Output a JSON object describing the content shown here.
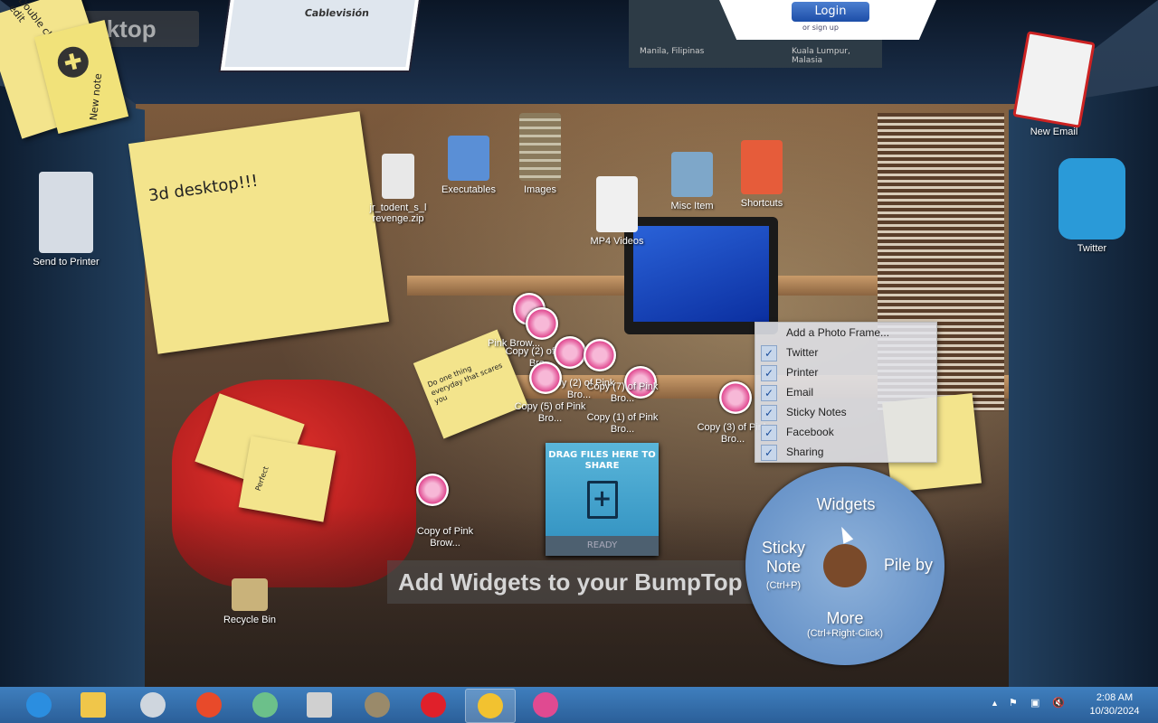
{
  "desktop": {
    "label": "Desktop"
  },
  "icons": [
    {
      "label": "jr_todent_s_l revenge.zip",
      "color": "#e8e8e8"
    },
    {
      "label": "Executables",
      "color": "#5a8fd6"
    },
    {
      "label": "Images",
      "color": "#8a7a5c"
    },
    {
      "label": "MP4 Videos",
      "color": "#f0f0f0"
    },
    {
      "label": "Misc Item",
      "color": "#7ea7c9"
    },
    {
      "label": "Shortcuts",
      "color": "#e65c3a"
    },
    {
      "label": "Recycle Bin",
      "color": "#c9b27a"
    },
    {
      "label": "Send to Printer",
      "color": "#d6dce4"
    },
    {
      "label": "New Email",
      "color": "#f2f2f2"
    },
    {
      "label": "Twitter",
      "color": "#2a9ad8"
    }
  ],
  "pink_items": [
    "Pink Brow...",
    "Copy (2) of Pink Bro...",
    "Copy (2) of Pink Bro...",
    "Copy (7) of Pink Bro...",
    "Copy (5) of Pink Bro...",
    "Copy (1) of Pink Bro...",
    "Copy (3) of Pink Bro...",
    "Copy of Pink Brow..."
  ],
  "stickies": {
    "main": "3d desktop!!!",
    "quote": "Do one thing everyday that scares you",
    "side1": "Double click to edit",
    "new_note": "New note",
    "perfect": "Perfect"
  },
  "share": {
    "title": "DRAG FILES HERE TO SHARE",
    "status": "READY"
  },
  "banner": "Add Widgets to your BumpTop",
  "ceiling": {
    "login": "Login",
    "signup": "or sign up",
    "cable": "Cablevisión",
    "manila": "Manila, Filipinas",
    "kuala": "Kuala Lumpur, Malasia"
  },
  "menu": {
    "add_photo": "Add a Photo Frame...",
    "items": [
      {
        "label": "Twitter",
        "checked": true
      },
      {
        "label": "Printer",
        "checked": true
      },
      {
        "label": "Email",
        "checked": true
      },
      {
        "label": "Sticky Notes",
        "checked": true
      },
      {
        "label": "Facebook",
        "checked": true
      },
      {
        "label": "Sharing",
        "checked": true
      }
    ],
    "check": "✓"
  },
  "pie": {
    "top": "Widgets",
    "left": "Sticky Note",
    "left_hint": "(Ctrl+P)",
    "right": "Pile by",
    "bottom": "More",
    "bottom_hint": "(Ctrl+Right-Click)"
  },
  "taskbar": {
    "apps": [
      {
        "name": "internet-explorer-icon",
        "color": "#2b8ee0",
        "active": false
      },
      {
        "name": "file-explorer-icon",
        "color": "#f0c64a",
        "active": false
      },
      {
        "name": "media-player-icon",
        "color": "#cfd6de",
        "active": false
      },
      {
        "name": "bumptop-icon",
        "color": "#e84a2a",
        "active": false
      },
      {
        "name": "recycle-app-icon",
        "color": "#6cc08a",
        "active": false
      },
      {
        "name": "scanner-icon",
        "color": "#d0d0d0",
        "active": false
      },
      {
        "name": "gimp-icon",
        "color": "#9a8a6a",
        "active": false
      },
      {
        "name": "opera-icon",
        "color": "#e0202a",
        "active": false
      },
      {
        "name": "chrome-icon",
        "color": "#f2c230",
        "active": true
      },
      {
        "name": "pink-browser-icon",
        "color": "#e04a91",
        "active": false
      }
    ],
    "time": "2:08 AM",
    "date": "10/30/2024",
    "tray_up": "▲",
    "tray_flag": "⚑",
    "tray_network": "▣",
    "tray_volume": "🔇"
  }
}
